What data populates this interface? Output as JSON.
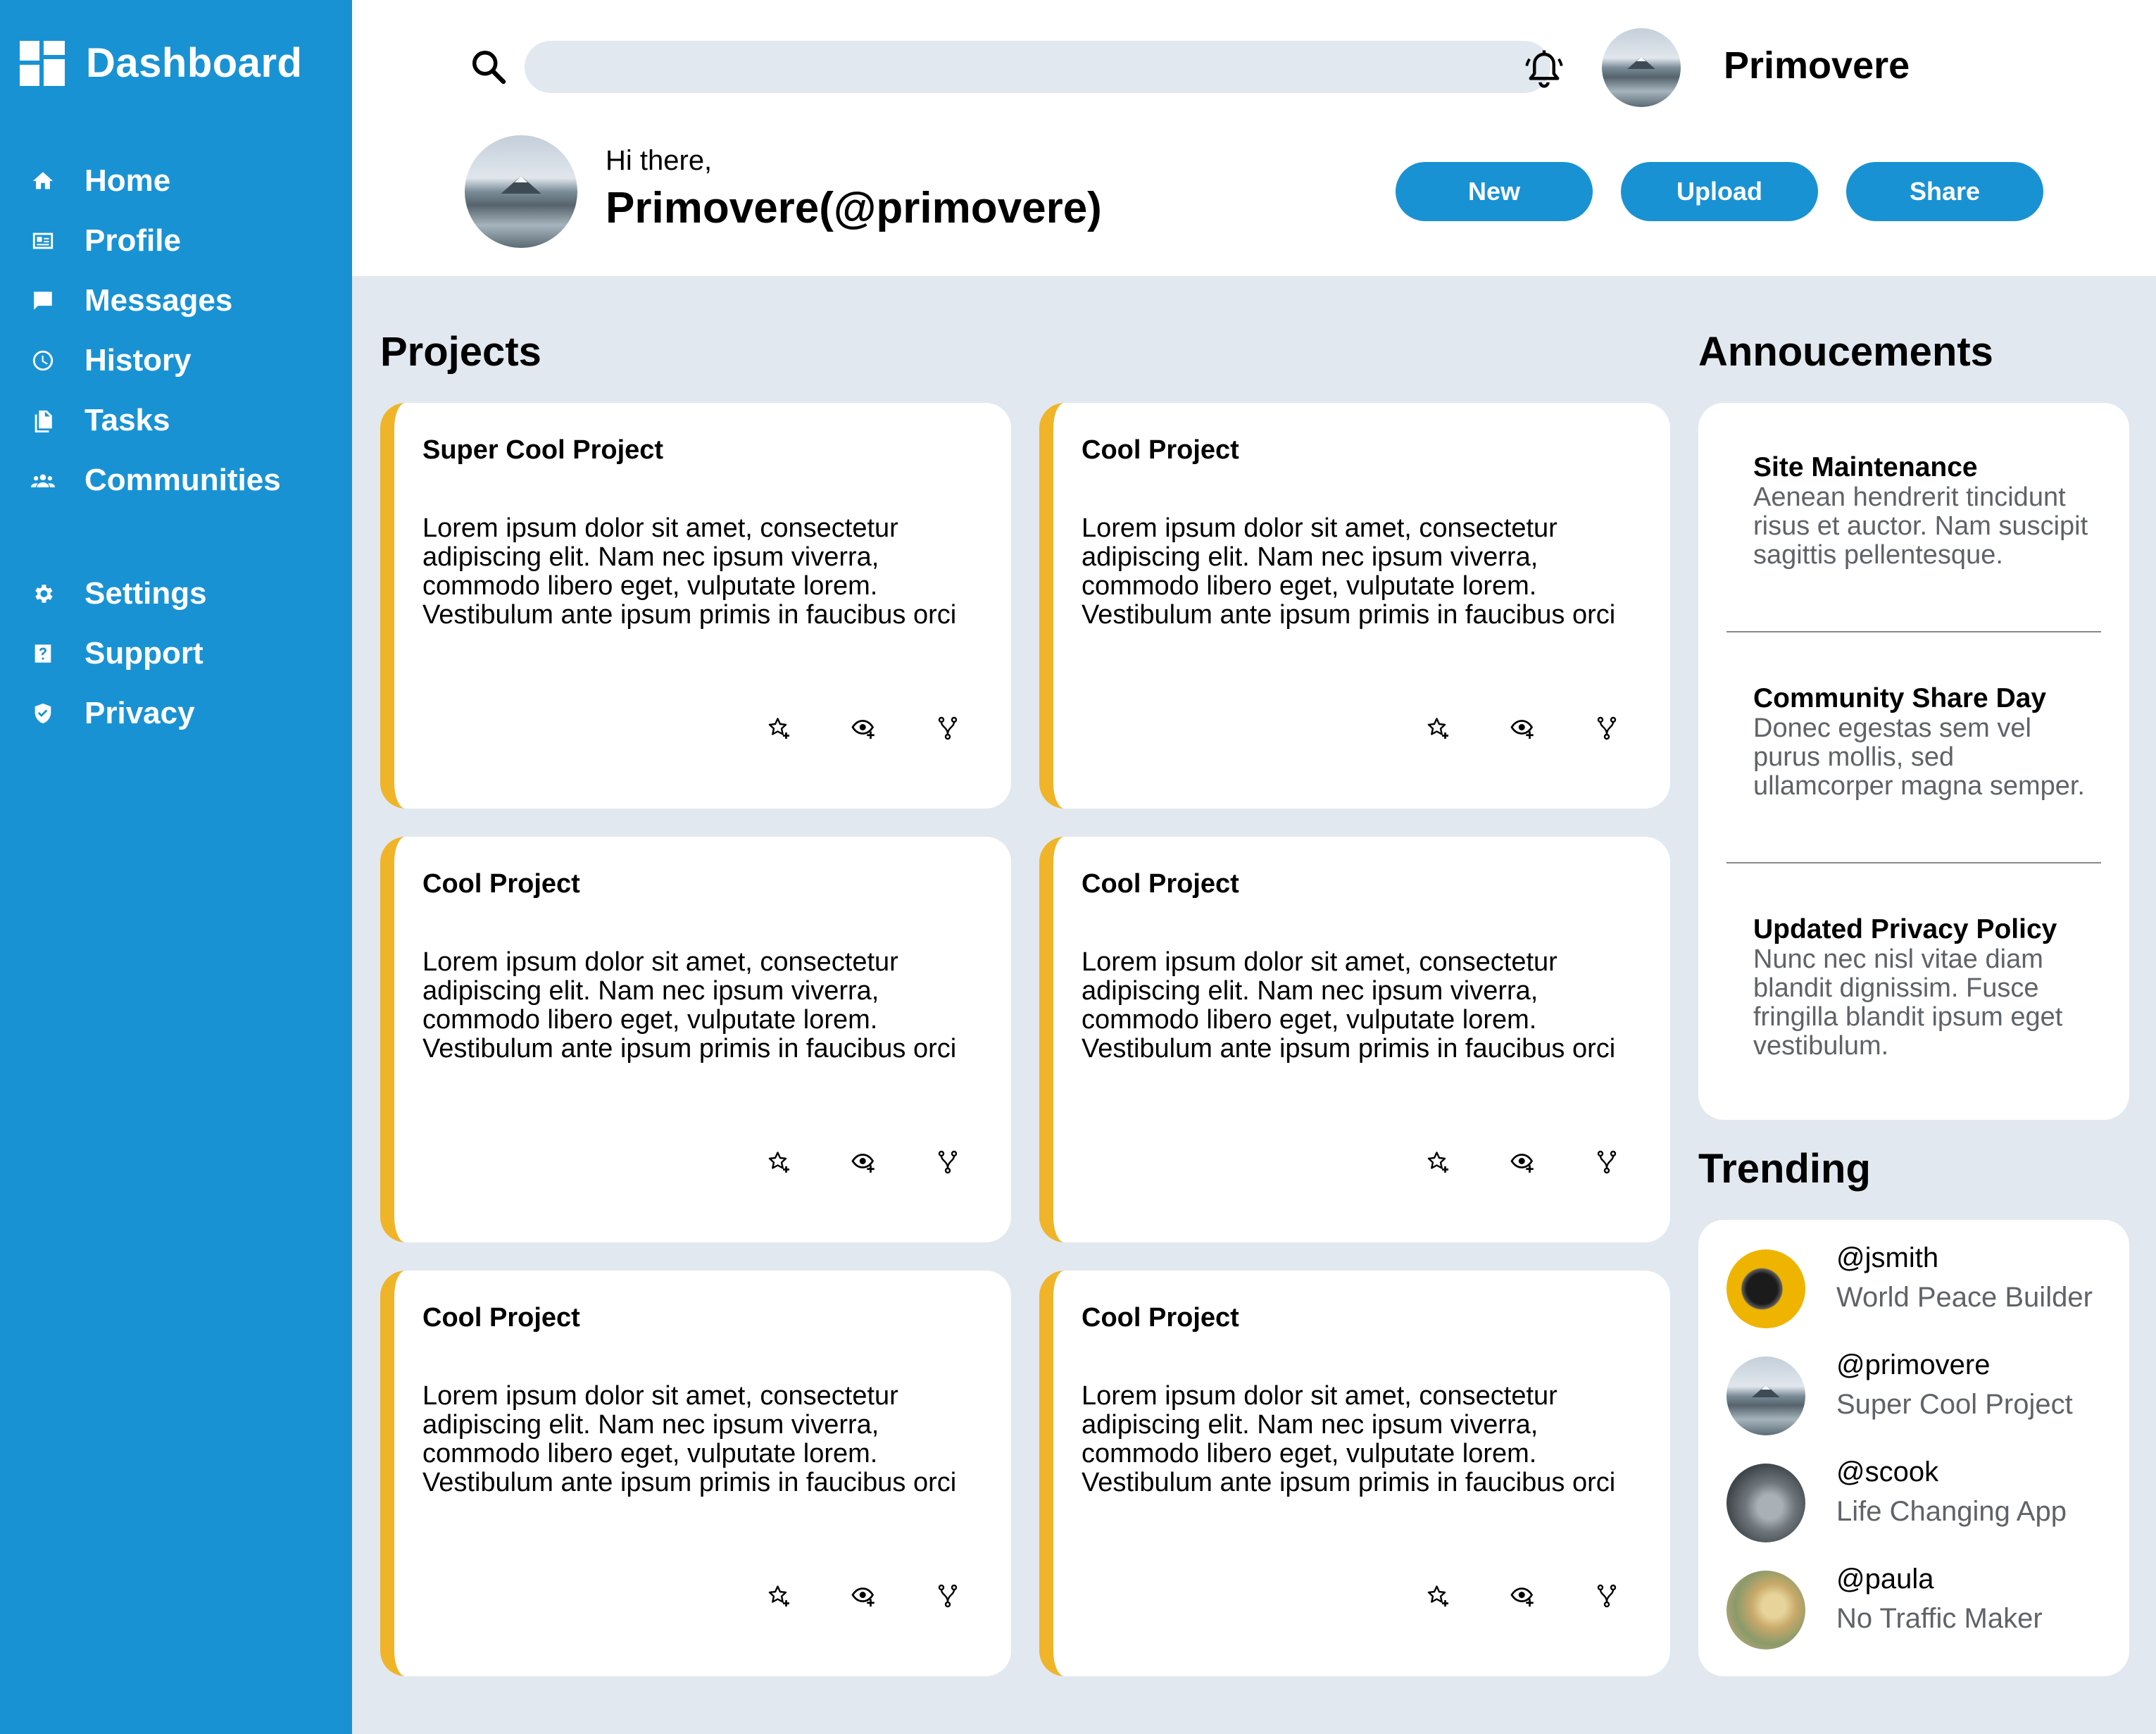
{
  "sidebar": {
    "brand": "Dashboard",
    "nav_primary": [
      {
        "label": "Home",
        "icon": "home-icon"
      },
      {
        "label": "Profile",
        "icon": "id-card-icon"
      },
      {
        "label": "Messages",
        "icon": "message-icon"
      },
      {
        "label": "History",
        "icon": "clock-icon"
      },
      {
        "label": "Tasks",
        "icon": "document-icon"
      },
      {
        "label": "Communities",
        "icon": "people-icon"
      }
    ],
    "nav_secondary": [
      {
        "label": "Settings",
        "icon": "gear-icon"
      },
      {
        "label": "Support",
        "icon": "help-icon"
      },
      {
        "label": "Privacy",
        "icon": "shield-icon"
      }
    ]
  },
  "header": {
    "search_placeholder": "",
    "username": "Primovere",
    "greeting": "Hi there,",
    "fullname": "Primovere(@primovere)",
    "buttons": {
      "new": "New",
      "upload": "Upload",
      "share": "Share"
    }
  },
  "projects": {
    "title": "Projects",
    "cards": [
      {
        "title": "Super Cool Project",
        "description": "Lorem ipsum dolor sit amet, consectetur adipiscing elit. Nam nec ipsum viverra, commodo libero eget, vulputate lorem. Vestibulum ante ipsum primis in faucibus orci"
      },
      {
        "title": "Cool Project",
        "description": "Lorem ipsum dolor sit amet, consectetur adipiscing elit. Nam nec ipsum viverra, commodo libero eget, vulputate lorem. Vestibulum ante ipsum primis in faucibus orci"
      },
      {
        "title": "Cool Project",
        "description": "Lorem ipsum dolor sit amet, consectetur adipiscing elit. Nam nec ipsum viverra, commodo libero eget, vulputate lorem. Vestibulum ante ipsum primis in faucibus orci"
      },
      {
        "title": "Cool Project",
        "description": "Lorem ipsum dolor sit amet, consectetur adipiscing elit. Nam nec ipsum viverra, commodo libero eget, vulputate lorem. Vestibulum ante ipsum primis in faucibus orci"
      },
      {
        "title": "Cool Project",
        "description": "Lorem ipsum dolor sit amet, consectetur adipiscing elit. Nam nec ipsum viverra, commodo libero eget, vulputate lorem. Vestibulum ante ipsum primis in faucibus orci"
      },
      {
        "title": "Cool Project",
        "description": "Lorem ipsum dolor sit amet, consectetur adipiscing elit. Nam nec ipsum viverra, commodo libero eget, vulputate lorem. Vestibulum ante ipsum primis in faucibus orci"
      }
    ],
    "card_actions": [
      "star-add-icon",
      "watch-icon",
      "fork-icon"
    ]
  },
  "announcements": {
    "title": "Annoucements",
    "items": [
      {
        "title": "Site Maintenance",
        "body": "Aenean hendrerit tincidunt risus et auctor. Nam suscipit sagittis pellentesque."
      },
      {
        "title": "Community Share Day",
        "body": "Donec egestas sem vel purus mollis, sed ullamcorper magna semper."
      },
      {
        "title": "Updated Privacy Policy",
        "body": "Nunc nec nisl vitae diam blandit dignissim. Fusce fringilla blandit ipsum eget vestibulum."
      }
    ]
  },
  "trending": {
    "title": "Trending",
    "items": [
      {
        "handle": "@jsmith",
        "description": "World Peace Builder"
      },
      {
        "handle": "@primovere",
        "description": "Super Cool Project"
      },
      {
        "handle": "@scook",
        "description": "Life Changing App"
      },
      {
        "handle": "@paula",
        "description": "No Traffic Maker"
      }
    ]
  },
  "colors": {
    "sidebar": "#1992d4",
    "accent": "#f0b429",
    "background": "#e2e8f0",
    "muted_text": "#5f6368"
  }
}
